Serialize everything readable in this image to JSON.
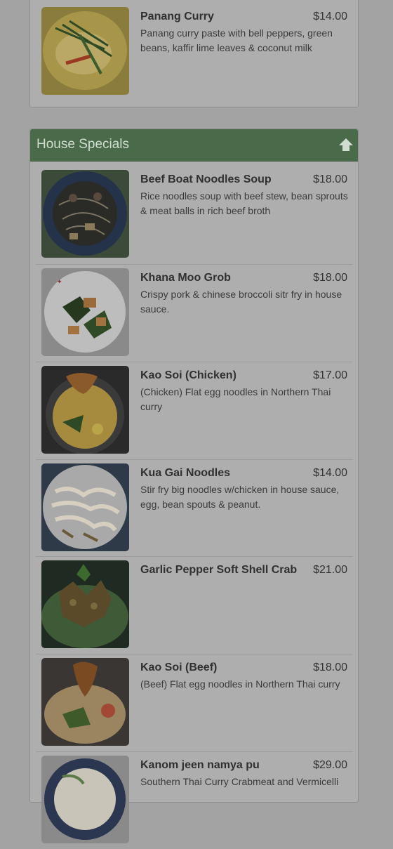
{
  "sections": [
    {
      "title": "",
      "items": [
        {
          "name": "Panang Curry",
          "price": "$14.00",
          "description": "Panang curry paste with bell peppers, green beans, kaffir lime leaves & coconut milk"
        }
      ]
    },
    {
      "title": "House Specials",
      "items": [
        {
          "name": "Beef Boat Noodles Soup",
          "price": "$18.00",
          "description": "Rice noodles soup with beef stew, bean sprouts & meat balls in rich beef broth"
        },
        {
          "name": "Khana Moo Grob",
          "price": "$18.00",
          "description": "Crispy pork & chinese broccoli sitr fry in house sauce."
        },
        {
          "name": "Kao Soi (Chicken)",
          "price": "$17.00",
          "description": "(Chicken) Flat egg noodles in Northern Thai curry"
        },
        {
          "name": "Kua Gai Noodles",
          "price": "$14.00",
          "description": "Stir fry big noodles w/chicken in house sauce, egg, bean spouts & peanut."
        },
        {
          "name": "Garlic Pepper Soft Shell Crab",
          "price": "$21.00",
          "description": ""
        },
        {
          "name": "Kao Soi (Beef)",
          "price": "$18.00",
          "description": "(Beef) Flat egg noodles in Northern Thai curry"
        },
        {
          "name": "Kanom jeen namya pu",
          "price": "$29.00",
          "description": "Southern Thai Curry Crabmeat and Vermicelli"
        }
      ]
    }
  ],
  "icons": {
    "scroll_up": "arrow-up-icon"
  },
  "colors": {
    "heading_bg": "#4a6b4a",
    "heading_text": "#d1ddd1"
  }
}
